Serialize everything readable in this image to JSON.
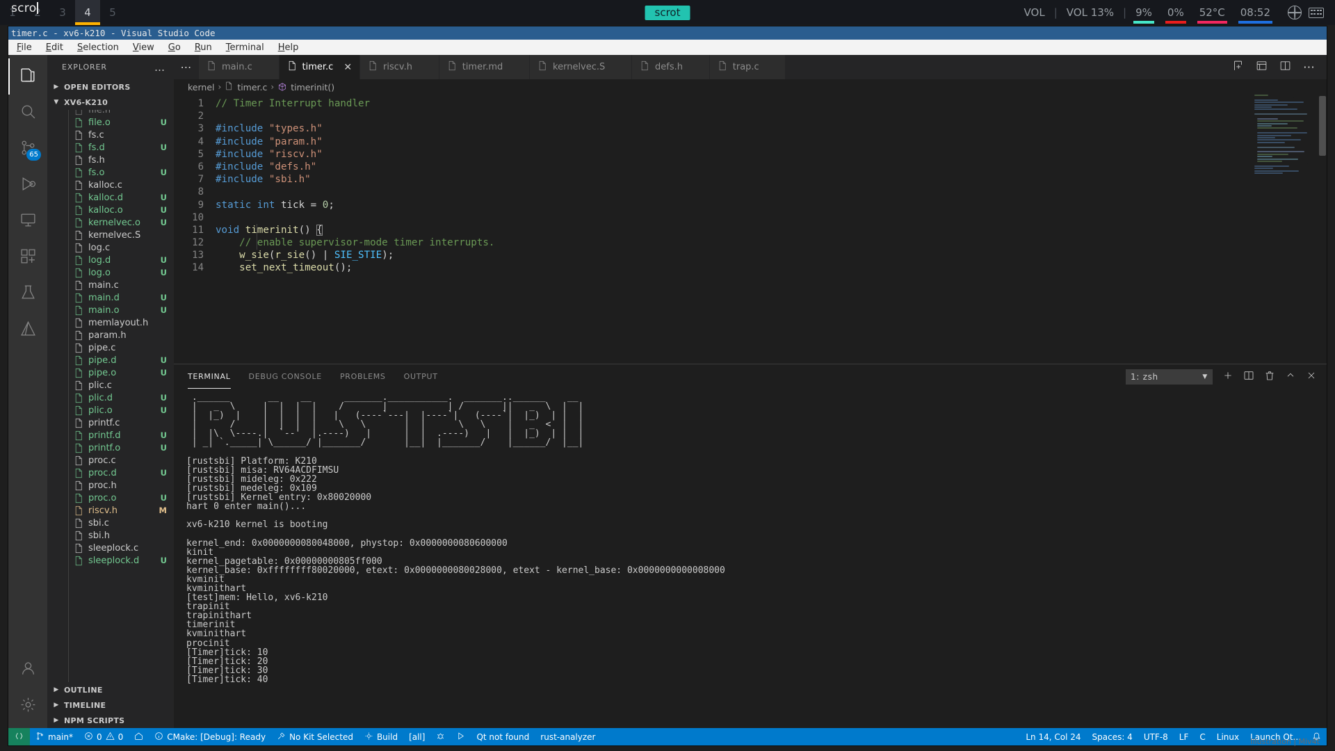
{
  "polybar": {
    "prompt_text": "scro",
    "workspaces": [
      {
        "label": "1",
        "active": false
      },
      {
        "label": "2",
        "active": false
      },
      {
        "label": "3",
        "active": false
      },
      {
        "label": "4",
        "active": true
      },
      {
        "label": "5",
        "active": false
      }
    ],
    "center_label": "scrot",
    "modules": [
      {
        "name": "volume-muted",
        "label": "VOL",
        "underline": ""
      },
      {
        "name": "separator",
        "label": "|",
        "underline": ""
      },
      {
        "name": "volume",
        "label": "VOL 13%",
        "underline": ""
      },
      {
        "name": "separator2",
        "label": "|",
        "underline": ""
      },
      {
        "name": "cpu",
        "label": "9%",
        "underline": "#46e6c8"
      },
      {
        "name": "memory",
        "label": "0%",
        "underline": "#e81d1d"
      },
      {
        "name": "temperature",
        "label": "52°C",
        "underline": "#f2275f"
      },
      {
        "name": "clock",
        "label": "08:52",
        "underline": "#1e6fe0"
      }
    ]
  },
  "window": {
    "title": "timer.c - xv6-k210 - Visual Studio Code",
    "menu": [
      "File",
      "Edit",
      "Selection",
      "View",
      "Go",
      "Run",
      "Terminal",
      "Help"
    ]
  },
  "activitybar": {
    "items": [
      {
        "name": "explorer",
        "icon": "files-icon",
        "badge": ""
      },
      {
        "name": "search",
        "icon": "search-icon",
        "badge": ""
      },
      {
        "name": "scm",
        "icon": "source-control-icon",
        "badge": "65"
      },
      {
        "name": "debug",
        "icon": "run-debug-icon",
        "badge": ""
      },
      {
        "name": "remote",
        "icon": "remote-explorer-icon",
        "badge": ""
      },
      {
        "name": "extensions",
        "icon": "extensions-icon",
        "badge": ""
      },
      {
        "name": "testing",
        "icon": "beaker-icon",
        "badge": ""
      },
      {
        "name": "cmake",
        "icon": "cmake-icon",
        "badge": ""
      }
    ],
    "bottom": [
      {
        "name": "accounts",
        "icon": "account-icon"
      },
      {
        "name": "settings",
        "icon": "gear-icon"
      }
    ]
  },
  "explorer": {
    "title": "EXPLORER",
    "more_label": "…",
    "open_editors_label": "OPEN EDITORS",
    "project_label": "XV6-K210",
    "outline_label": "OUTLINE",
    "timeline_label": "TIMELINE",
    "npm_scripts_label": "NPM SCRIPTS",
    "files": [
      {
        "name": "file.h",
        "status": "",
        "cut": true
      },
      {
        "name": "file.o",
        "status": "U"
      },
      {
        "name": "fs.c",
        "status": ""
      },
      {
        "name": "fs.d",
        "status": "U"
      },
      {
        "name": "fs.h",
        "status": ""
      },
      {
        "name": "fs.o",
        "status": "U"
      },
      {
        "name": "kalloc.c",
        "status": ""
      },
      {
        "name": "kalloc.d",
        "status": "U"
      },
      {
        "name": "kalloc.o",
        "status": "U"
      },
      {
        "name": "kernelvec.o",
        "status": "U"
      },
      {
        "name": "kernelvec.S",
        "status": ""
      },
      {
        "name": "log.c",
        "status": ""
      },
      {
        "name": "log.d",
        "status": "U"
      },
      {
        "name": "log.o",
        "status": "U"
      },
      {
        "name": "main.c",
        "status": ""
      },
      {
        "name": "main.d",
        "status": "U"
      },
      {
        "name": "main.o",
        "status": "U"
      },
      {
        "name": "memlayout.h",
        "status": ""
      },
      {
        "name": "param.h",
        "status": ""
      },
      {
        "name": "pipe.c",
        "status": ""
      },
      {
        "name": "pipe.d",
        "status": "U"
      },
      {
        "name": "pipe.o",
        "status": "U"
      },
      {
        "name": "plic.c",
        "status": ""
      },
      {
        "name": "plic.d",
        "status": "U"
      },
      {
        "name": "plic.o",
        "status": "U"
      },
      {
        "name": "printf.c",
        "status": ""
      },
      {
        "name": "printf.d",
        "status": "U"
      },
      {
        "name": "printf.o",
        "status": "U"
      },
      {
        "name": "proc.c",
        "status": ""
      },
      {
        "name": "proc.d",
        "status": "U"
      },
      {
        "name": "proc.h",
        "status": ""
      },
      {
        "name": "proc.o",
        "status": "U"
      },
      {
        "name": "riscv.h",
        "status": "M"
      },
      {
        "name": "sbi.c",
        "status": ""
      },
      {
        "name": "sbi.h",
        "status": ""
      },
      {
        "name": "sleeplock.c",
        "status": ""
      },
      {
        "name": "sleeplock.d",
        "status": "U"
      }
    ]
  },
  "tabs": [
    {
      "label": "main.c",
      "active": false
    },
    {
      "label": "timer.c",
      "active": true
    },
    {
      "label": "riscv.h",
      "active": false
    },
    {
      "label": "timer.md",
      "active": false
    },
    {
      "label": "kernelvec.S",
      "active": false
    },
    {
      "label": "defs.h",
      "active": false
    },
    {
      "label": "trap.c",
      "active": false
    }
  ],
  "breadcrumbs": [
    "kernel",
    "timer.c",
    "timerinit()"
  ],
  "code": {
    "first_line": 1,
    "lines": [
      {
        "n": 1,
        "html": "<span class=\"t-com\">// Timer Interrupt handler</span>"
      },
      {
        "n": 2,
        "html": ""
      },
      {
        "n": 3,
        "html": "<span class=\"t-pre\">#include</span> <span class=\"t-str\">\"types.h\"</span>"
      },
      {
        "n": 4,
        "html": "<span class=\"t-pre\">#include</span> <span class=\"t-str\">\"param.h\"</span>"
      },
      {
        "n": 5,
        "html": "<span class=\"t-pre\">#include</span> <span class=\"t-str\">\"riscv.h\"</span>"
      },
      {
        "n": 6,
        "html": "<span class=\"t-pre\">#include</span> <span class=\"t-str\">\"defs.h\"</span>"
      },
      {
        "n": 7,
        "html": "<span class=\"t-pre\">#include</span> <span class=\"t-str\">\"sbi.h\"</span>"
      },
      {
        "n": 8,
        "html": ""
      },
      {
        "n": 9,
        "html": "<span class=\"t-kw\">static</span> <span class=\"t-kw\">int</span> tick = <span class=\"t-num\">0</span>;"
      },
      {
        "n": 10,
        "html": ""
      },
      {
        "n": 11,
        "html": "<span class=\"t-kw\">void</span> <span class=\"t-fn\">timerinit</span>() <span class=\"brk-hl\">{</span>"
      },
      {
        "n": 12,
        "html": "    <span class=\"t-com\">// enable supervisor-mode timer interrupts.</span>"
      },
      {
        "n": 13,
        "html": "    <span class=\"t-fn\">w_sie</span>(<span class=\"t-fn\">r_sie</span>() | <span class=\"t-const\">SIE_STIE</span>);"
      },
      {
        "n": 14,
        "html": "    <span class=\"t-fn\">set_next_timeout</span>();"
      }
    ]
  },
  "panel": {
    "tabs": [
      {
        "label": "TERMINAL",
        "active": true
      },
      {
        "label": "DEBUG CONSOLE",
        "active": false
      },
      {
        "label": "PROBLEMS",
        "active": false
      },
      {
        "label": "OUTPUT",
        "active": false
      }
    ],
    "terminal_selector": "1: zsh",
    "actions": [
      "new-terminal",
      "split-terminal",
      "kill-terminal",
      "maximize-panel",
      "close-panel"
    ]
  },
  "terminal_output": [
    " .______       __    __      _______.___________.  _______..______    __ ",
    " |   _  \\     |  |  |  |    /       |           | /       ||   _  \\  |  |",
    " |  |_)  |    |  |  |  |   |   (----`---|  |----`|   (----`|  |_)  | |  |",
    " |      /     |  |  |  |    \\   \\       |  |      \\   \\    |   _  <  |  |",
    " |  |\\  \\----.|  `--'  |.----)   |      |  |  .----)   |   |  |_)  | |  |",
    " | _| `._____| \\______/ |_______/       |__|  |_______/    |______/  |__|",
    "",
    "[rustsbi] Platform: K210",
    "[rustsbi] misa: RV64ACDFIMSU",
    "[rustsbi] mideleg: 0x222",
    "[rustsbi] medeleg: 0x109",
    "[rustsbi] Kernel entry: 0x80020000",
    "hart 0 enter main()...",
    "",
    "xv6-k210 kernel is booting",
    "",
    "kernel_end: 0x0000000080048000, phystop: 0x0000000080600000",
    "kinit",
    "kernel_pagetable: 0x00000000805ff000",
    "kernel_base: 0xffffffff80020000, etext: 0x0000000080028000, etext - kernel_base: 0x0000000000008000",
    "kvminit",
    "kvminithart",
    "[test]mem: Hello, xv6-k210",
    "trapinit",
    "trapinithart",
    "timerinit",
    "kvminithart",
    "procinit",
    "[Timer]tick: 10",
    "[Timer]tick: 20",
    "[Timer]tick: 30",
    "[Timer]tick: 40"
  ],
  "statusbar": {
    "left": [
      {
        "name": "remote-indicator",
        "label": "",
        "icon": "remote-icon"
      },
      {
        "name": "branch",
        "label": "main*",
        "icon": "git-branch-icon"
      },
      {
        "name": "problems",
        "label": "0  0",
        "icon": "error-warning-icon"
      },
      {
        "name": "home",
        "label": "",
        "icon": "home-icon"
      },
      {
        "name": "cmake-status",
        "label": "CMake: [Debug]: Ready",
        "icon": "info-icon"
      },
      {
        "name": "kit",
        "label": "No Kit Selected",
        "icon": "tools-icon"
      },
      {
        "name": "build",
        "label": "Build",
        "icon": "gear-icon"
      },
      {
        "name": "build-target",
        "label": "[all]",
        "icon": ""
      },
      {
        "name": "debug-target",
        "label": "",
        "icon": "bug-icon"
      },
      {
        "name": "launch-run",
        "label": "",
        "icon": "play-icon"
      },
      {
        "name": "qt",
        "label": "Qt not found",
        "icon": ""
      },
      {
        "name": "rust-analyzer",
        "label": "rust-analyzer",
        "icon": ""
      }
    ],
    "right": [
      {
        "name": "cursor-position",
        "label": "Ln 14, Col 24"
      },
      {
        "name": "indentation",
        "label": "Spaces: 4"
      },
      {
        "name": "encoding",
        "label": "UTF-8"
      },
      {
        "name": "eol",
        "label": "LF"
      },
      {
        "name": "language-mode",
        "label": "C"
      },
      {
        "name": "platform",
        "label": "Linux"
      },
      {
        "name": "launch-target",
        "label": "Launch Qt..."
      },
      {
        "name": "notifications",
        "label": ""
      }
    ]
  },
  "watermark": "Illustration | Miv4t",
  "colors": {
    "accent": "#007acc",
    "titlebar": "#2a5d8f",
    "modified": "#73c991",
    "modifiedM": "#e2c08d",
    "polybar_highlight": "#ffb300",
    "scrot_badge": "#22c3b0"
  }
}
